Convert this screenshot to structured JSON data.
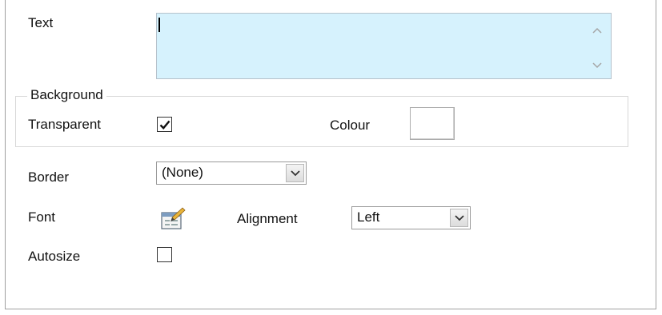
{
  "text_field": {
    "label": "Text",
    "value": ""
  },
  "background": {
    "title": "Background",
    "transparent_label": "Transparent",
    "transparent_checked": true,
    "colour_label": "Colour",
    "colour_value": "#ffffff"
  },
  "border": {
    "label": "Border",
    "value": "(None)"
  },
  "font": {
    "label": "Font",
    "button_icon": "font-picker-icon"
  },
  "alignment": {
    "label": "Alignment",
    "value": "Left"
  },
  "autosize": {
    "label": "Autosize",
    "checked": false
  },
  "colors": {
    "text_bg": "#d6f2fd",
    "border": "#a0a0a0"
  }
}
